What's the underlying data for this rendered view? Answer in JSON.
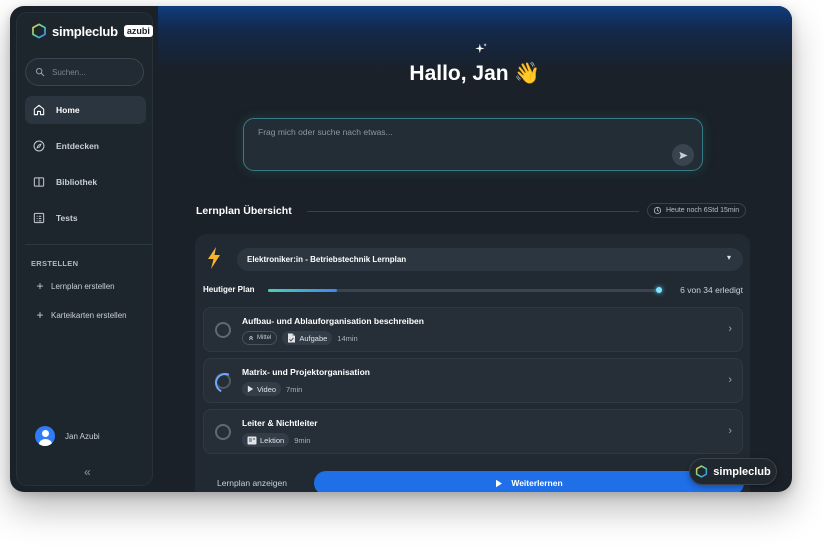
{
  "brand": {
    "name": "simpleclub",
    "badge": "azubi"
  },
  "search": {
    "placeholder": "Suchen..."
  },
  "sidebar": {
    "items": [
      {
        "label": "Home",
        "icon": "home-icon",
        "active": true
      },
      {
        "label": "Entdecken",
        "icon": "compass-icon",
        "active": false
      },
      {
        "label": "Bibliothek",
        "icon": "book-icon",
        "active": false
      },
      {
        "label": "Tests",
        "icon": "checklist-icon",
        "active": false
      }
    ],
    "create_section": "ERSTELLEN",
    "create_items": [
      {
        "label": "Lernplan erstellen"
      },
      {
        "label": "Karteikarten erstellen"
      }
    ],
    "user": {
      "name": "Jan Azubi"
    },
    "collapse_icon": "chevrons-left-icon"
  },
  "main": {
    "sparkle_icon": "sparkle-icon",
    "greeting": "Hallo, Jan 👋",
    "ask": {
      "placeholder": "Frag mich oder suche nach etwas..."
    },
    "lernplan": {
      "title": "Lernplan Übersicht",
      "time_left": "Heute noch 6Std 15min",
      "selected_plan": "Elektroniker:in - Betriebstechnik Lernplan",
      "today_label": "Heutiger Plan",
      "progress_fraction": 0.176,
      "progress_text": "6 von 34 erledigt",
      "tasks": [
        {
          "title": "Aufbau- und Ablauforganisation beschreiben",
          "level": "Mittel",
          "type": "Aufgabe",
          "type_icon": "document-icon",
          "duration": "14min",
          "status": "open"
        },
        {
          "title": "Matrix- und Projektorganisation",
          "type": "Video",
          "type_icon": "play-icon",
          "duration": "7min",
          "status": "in-progress"
        },
        {
          "title": "Leiter & Nichtleiter",
          "type": "Lektion",
          "type_icon": "lesson-icon",
          "duration": "9min",
          "status": "open"
        }
      ],
      "show_plan": "Lernplan anzeigen",
      "continue": "Weiterlernen"
    }
  },
  "brand_badge": {
    "name": "simpleclub"
  },
  "colors": {
    "accent": "#1f6fe8",
    "bolt": "#f5b32f",
    "progress_start": "#49d0b5",
    "progress_end": "#3f86f0"
  }
}
